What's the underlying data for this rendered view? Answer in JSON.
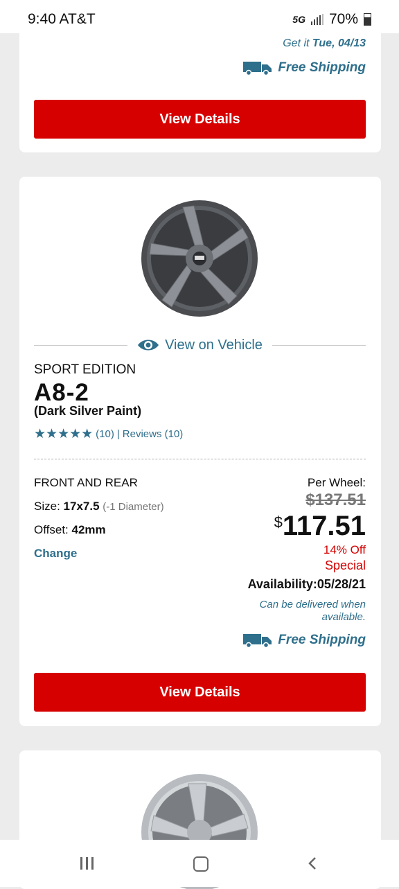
{
  "status": {
    "time_carrier": "9:40 AT&T",
    "network": "5G",
    "battery": "70%"
  },
  "card1": {
    "get_it_prefix": "Get it",
    "get_it_date": "Tue, 04/13",
    "free_shipping": "Free Shipping",
    "view_details": "View Details"
  },
  "product": {
    "view_on_vehicle": "View on Vehicle",
    "brand": "SPORT EDITION",
    "model": "A8-2",
    "finish": "(Dark Silver Paint)",
    "stars": "★★★★★",
    "rating_count": "(10)",
    "reviews": "Reviews (10)",
    "position": "FRONT AND REAR",
    "size_label": "Size:",
    "size_value": "17x7.5",
    "size_note": "(-1 Diameter)",
    "offset_label": "Offset:",
    "offset_value": "42mm",
    "change": "Change",
    "per_wheel": "Per Wheel:",
    "old_price": "$137.51",
    "currency": "$",
    "price": "117.51",
    "percent_off": "14% Off",
    "special": "Special",
    "availability": "Availability:05/28/21",
    "delivered_note": "Can be delivered when available.",
    "free_shipping": "Free Shipping",
    "view_details": "View Details"
  },
  "colors": {
    "accent_red": "#d60000",
    "link_teal": "#2e6f8c"
  },
  "icons": [
    "truck-icon",
    "eye-icon",
    "star-icon",
    "recent-apps-icon",
    "home-icon",
    "back-icon"
  ]
}
